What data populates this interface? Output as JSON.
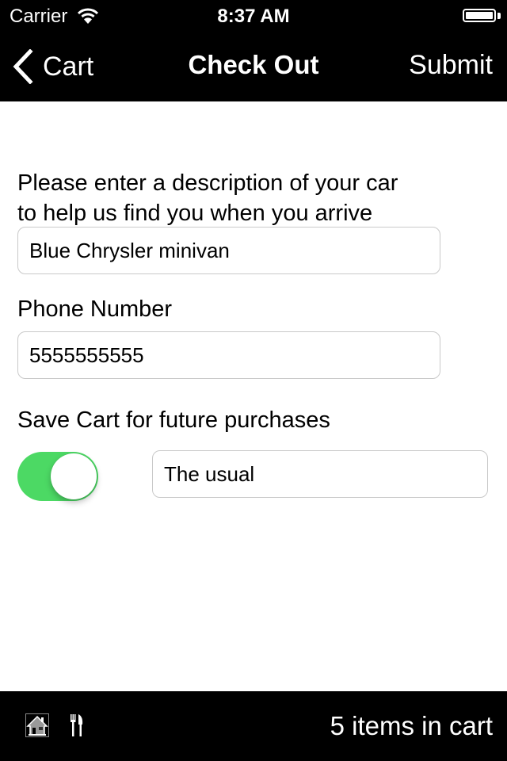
{
  "status_bar": {
    "carrier": "Carrier",
    "time": "8:37 AM",
    "wifi_icon": "wifi-icon",
    "battery_icon": "battery-icon"
  },
  "nav_bar": {
    "back_label": "Cart",
    "back_icon": "chevron-left-icon",
    "title": "Check Out",
    "submit_label": "Submit"
  },
  "form": {
    "car_description": {
      "label": "Please enter a description of your car to help us find you when you arrive",
      "label_line1": "Please enter a description of your car",
      "label_line2": "to help us find you when you arrive",
      "value": "Blue Chrysler minivan"
    },
    "phone": {
      "label": "Phone Number",
      "value": "5555555555"
    },
    "save_cart": {
      "label": "Save Cart for future purchases",
      "toggle_on": true,
      "name_value": "The usual"
    }
  },
  "bottom_bar": {
    "icons": [
      "home-icon",
      "fork-knife-icon"
    ],
    "cart_status": "5 items in cart"
  },
  "colors": {
    "bar_background": "#000000",
    "toggle_on": "#4cd964",
    "field_border": "#c9c9c9"
  }
}
